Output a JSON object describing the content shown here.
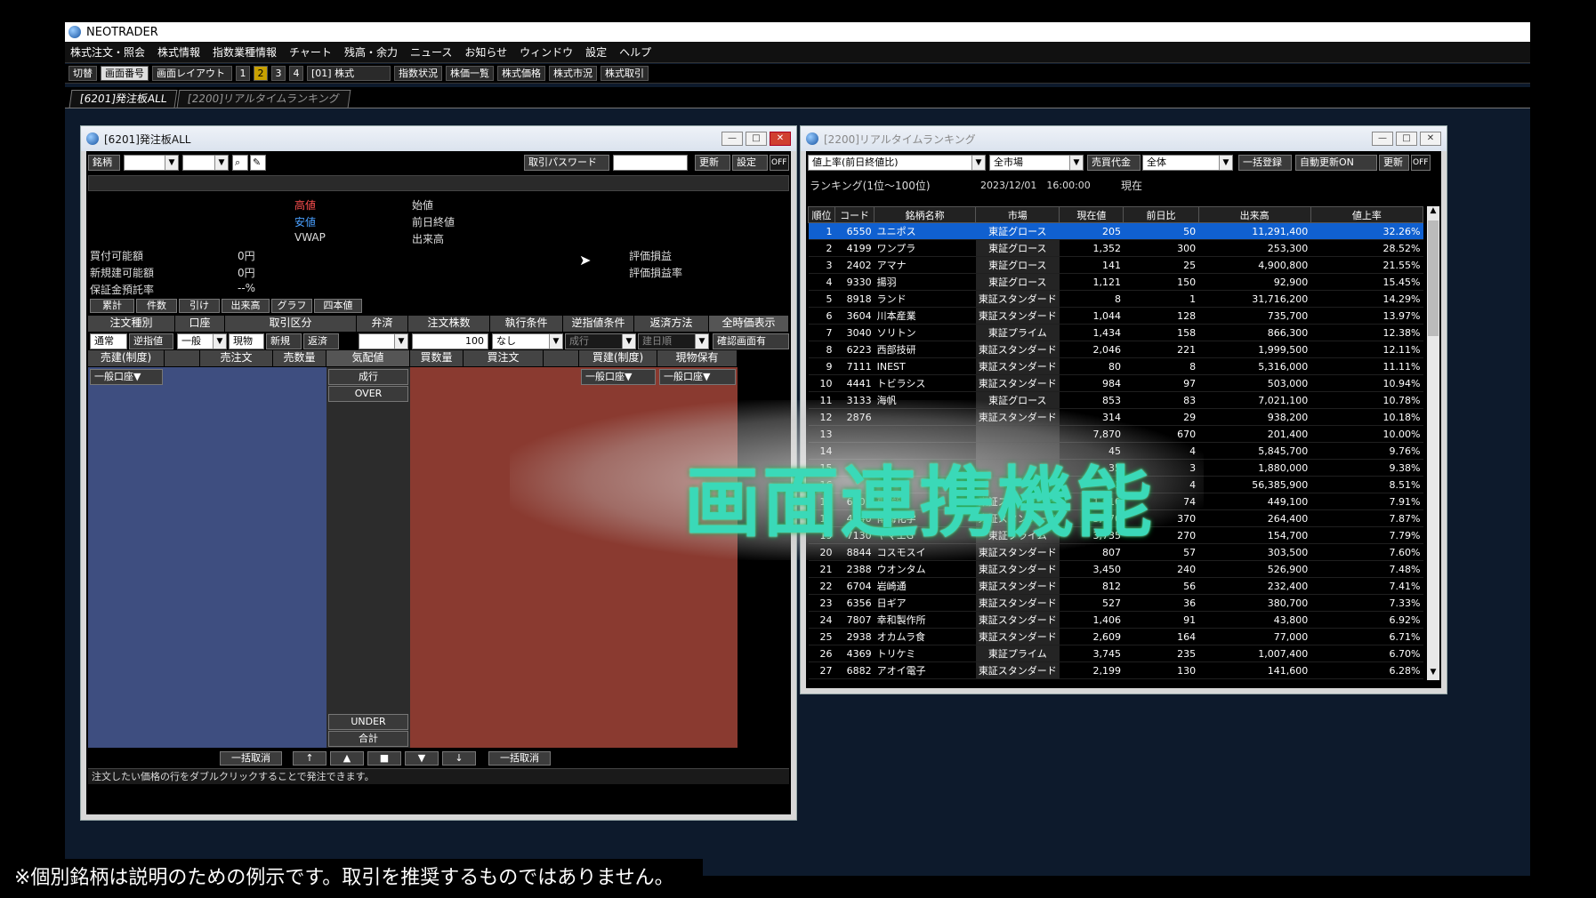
{
  "app": {
    "title": "NEOTRADER"
  },
  "menu": [
    "株式注文・照会",
    "株式情報",
    "指数業種情報",
    "チャート",
    "残高・余力",
    "ニュース",
    "お知らせ",
    "ウィンドウ",
    "設定",
    "ヘルプ"
  ],
  "toolbar": {
    "switch": "切替",
    "screen_no": "画面番号",
    "layout": "画面レイアウト",
    "nums": [
      "1",
      "2",
      "3",
      "4"
    ],
    "account": "[01] 株式",
    "buttons": [
      "指数状況",
      "株価一覧",
      "株式価格",
      "株式市況",
      "株式取引"
    ]
  },
  "tabs": [
    "[6201]発注板ALL",
    "[2200]リアルタイムランキング"
  ],
  "order_window": {
    "title": "[6201]発注板ALL",
    "brand_label": "銘柄",
    "password_btn": "取引パスワード",
    "update_btn": "更新",
    "settings_btn": "設定",
    "off": "OFF",
    "prices": {
      "high": "高値",
      "low": "安値",
      "vwap": "VWAP",
      "open": "始値",
      "prev_close": "前日終値",
      "volume": "出来高"
    },
    "funds": [
      {
        "label": "買付可能額",
        "value": "0円"
      },
      {
        "label": "新規建可能額",
        "value": "0円"
      },
      {
        "label": "保証金預託率",
        "value": "--%"
      }
    ],
    "pnl": [
      "評価損益",
      "評価損益率"
    ],
    "subtabs": [
      "累計",
      "件数",
      "引け",
      "出来高",
      "グラフ",
      "四本値"
    ],
    "form_headers": [
      "注文種別",
      "口座",
      "取引区分",
      "弁済",
      "注文株数",
      "執行条件",
      "逆指値条件",
      "返済方法"
    ],
    "show_all": "全時価表示",
    "confirm": "確認画面有",
    "order_types": [
      "通常",
      "逆指値"
    ],
    "account_value": "一般",
    "trade_types": [
      "現物",
      "新規",
      "返済"
    ],
    "qty": "100",
    "exec_cond": "なし",
    "stop_cond": "成行",
    "repay": "建日順",
    "ladder_headers": [
      "売建(制度)",
      "売注文",
      "売数量",
      "気配値",
      "買数量",
      "買注文",
      "買建(制度)",
      "現物保有"
    ],
    "account_sel": "一般口座▼",
    "market": "成行",
    "over": "OVER",
    "under": "UNDER",
    "total": "合計",
    "cancel_all": "一括取消",
    "hint": "注文したい価格の行をダブルクリックすることで発注できます。"
  },
  "rank_window": {
    "title": "[2200]リアルタイムランキング",
    "type": "値上率(前日終値比)",
    "market": "全市場",
    "amount": "売買代金",
    "scope": "全体",
    "bulk_btn": "一括登録",
    "auto_btn": "自動更新ON",
    "update_btn": "更新",
    "off": "OFF",
    "range": "ランキング(1位〜100位)",
    "datetime": "2023/12/01　16:00:00",
    "now": "現在",
    "headers": [
      "順位",
      "コード",
      "銘柄名称",
      "市場",
      "現在値",
      "前日比",
      "出来高",
      "値上率"
    ],
    "rows": [
      [
        "1",
        "6550",
        "ユニポス",
        "東証グロース",
        "205",
        "50",
        "11,291,400",
        "32.26%"
      ],
      [
        "2",
        "4199",
        "ワンプラ",
        "東証グロース",
        "1,352",
        "300",
        "253,300",
        "28.52%"
      ],
      [
        "3",
        "2402",
        "アマナ",
        "東証グロース",
        "141",
        "25",
        "4,900,800",
        "21.55%"
      ],
      [
        "4",
        "9330",
        "揚羽",
        "東証グロース",
        "1,121",
        "150",
        "92,900",
        "15.45%"
      ],
      [
        "5",
        "8918",
        "ランド",
        "東証スタンダード",
        "8",
        "1",
        "31,716,200",
        "14.29%"
      ],
      [
        "6",
        "3604",
        "川本産業",
        "東証スタンダード",
        "1,044",
        "128",
        "735,700",
        "13.97%"
      ],
      [
        "7",
        "3040",
        "ソリトン",
        "東証プライム",
        "1,434",
        "158",
        "866,300",
        "12.38%"
      ],
      [
        "8",
        "6223",
        "西部技研",
        "東証スタンダード",
        "2,046",
        "221",
        "1,999,500",
        "12.11%"
      ],
      [
        "9",
        "7111",
        "INEST",
        "東証スタンダード",
        "80",
        "8",
        "5,316,000",
        "11.11%"
      ],
      [
        "10",
        "4441",
        "トビラシス",
        "東証スタンダード",
        "984",
        "97",
        "503,000",
        "10.94%"
      ],
      [
        "11",
        "3133",
        "海帆",
        "東証グロース",
        "853",
        "83",
        "7,021,100",
        "10.78%"
      ],
      [
        "12",
        "2876",
        "",
        "東証スタンダード",
        "314",
        "29",
        "938,200",
        "10.18%"
      ],
      [
        "13",
        "",
        "",
        "",
        "7,870",
        "670",
        "201,400",
        "10.00%"
      ],
      [
        "14",
        "",
        "",
        "",
        "45",
        "4",
        "5,845,700",
        "9.76%"
      ],
      [
        "15",
        "",
        "",
        "",
        "35",
        "3",
        "1,880,000",
        "9.38%"
      ],
      [
        "16",
        "",
        "",
        "",
        "51",
        "4",
        "56,385,900",
        "8.51%"
      ],
      [
        "17",
        "6505",
        "東洋電",
        "東証スタンダード",
        "1,010",
        "74",
        "449,100",
        "7.91%"
      ],
      [
        "18",
        "4040",
        "南海化学",
        "東証スタンダード",
        "5,070",
        "370",
        "264,400",
        "7.87%"
      ],
      [
        "19",
        "7130",
        "ヤマエG",
        "東証プライム",
        "3,735",
        "270",
        "154,700",
        "7.79%"
      ],
      [
        "20",
        "8844",
        "コスモスイ",
        "東証スタンダード",
        "807",
        "57",
        "303,500",
        "7.60%"
      ],
      [
        "21",
        "2388",
        "ウオンタム",
        "東証スタンダード",
        "3,450",
        "240",
        "526,900",
        "7.48%"
      ],
      [
        "22",
        "6704",
        "岩崎通",
        "東証スタンダード",
        "812",
        "56",
        "232,400",
        "7.41%"
      ],
      [
        "23",
        "6356",
        "日ギア",
        "東証スタンダード",
        "527",
        "36",
        "380,700",
        "7.33%"
      ],
      [
        "24",
        "7807",
        "幸和製作所",
        "東証スタンダード",
        "1,406",
        "91",
        "43,800",
        "6.92%"
      ],
      [
        "25",
        "2938",
        "オカムラ食",
        "東証スタンダード",
        "2,609",
        "164",
        "77,000",
        "6.71%"
      ],
      [
        "26",
        "4369",
        "トリケミ",
        "東証プライム",
        "3,745",
        "235",
        "1,007,400",
        "6.70%"
      ],
      [
        "27",
        "6882",
        "アオイ電子",
        "東証スタンダード",
        "2,199",
        "130",
        "141,600",
        "6.28%"
      ]
    ]
  },
  "overlay_text": "画面連携機能",
  "disclaimer": "※個別銘柄は説明のための例示です。取引を推奨するものではありません。"
}
